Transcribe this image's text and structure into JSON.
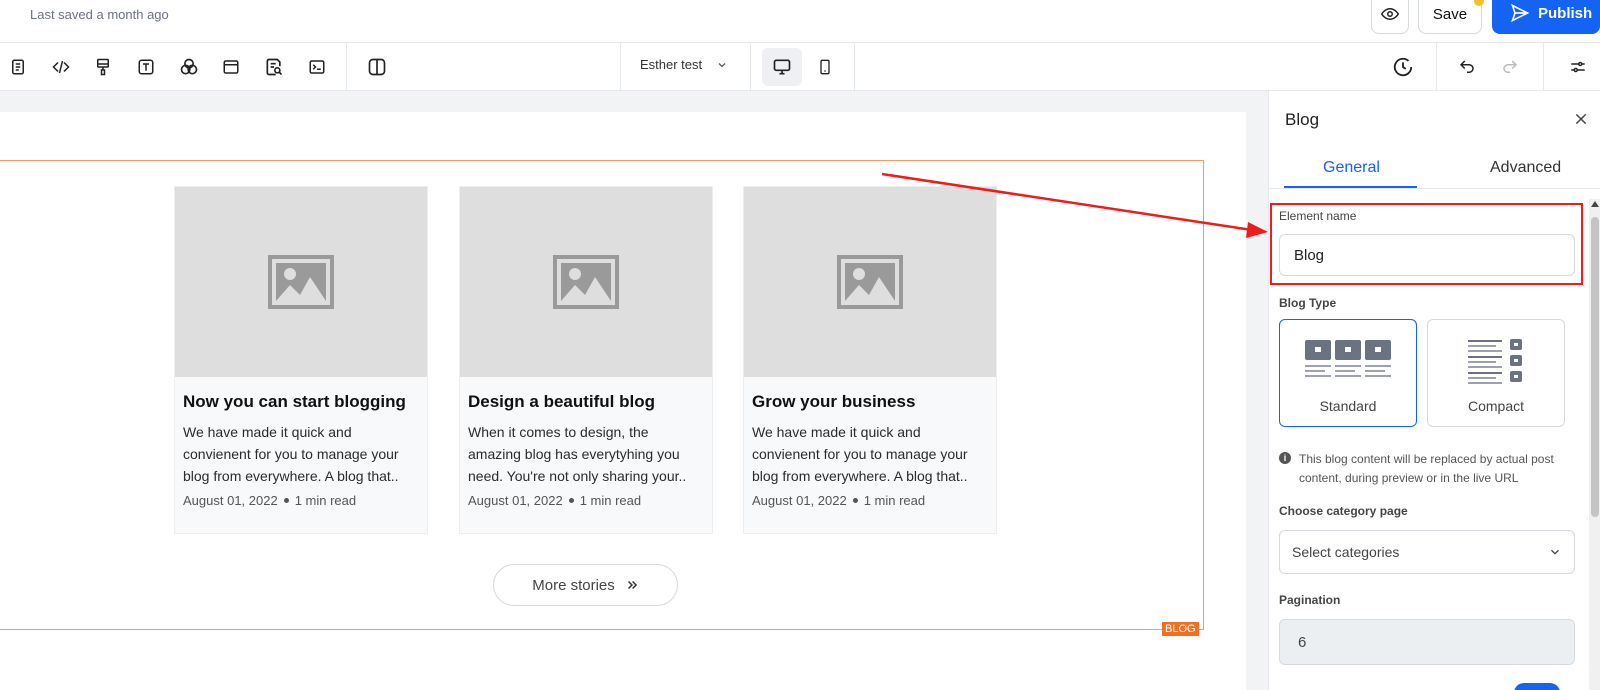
{
  "topbar": {
    "saved_text": "Last saved a month ago",
    "save_label": "Save",
    "publish_label": "Publish"
  },
  "toolbar": {
    "tools": [
      "page-icon",
      "code-icon",
      "paint-brush-icon",
      "text-icon",
      "shapes-icon",
      "layout-icon",
      "seo-search-icon",
      "terminal-icon",
      "columns-icon"
    ],
    "site_name": "Esther test",
    "devices": [
      "desktop",
      "mobile"
    ]
  },
  "canvas": {
    "section_tag": "BLOG",
    "posts": [
      {
        "title": "Now you can start blogging",
        "excerpt": "We have made it quick and convienent for you to manage your blog from everywhere. A blog that..",
        "date": "August 01, 2022",
        "read_time": "1 min read"
      },
      {
        "title": "Design a beautiful blog",
        "excerpt": "When it comes to design, the amazing blog has everytyhing you need. You're not only sharing your..",
        "date": "August 01, 2022",
        "read_time": "1 min read"
      },
      {
        "title": "Grow your business",
        "excerpt": "We have made it quick and convienent for you to manage your blog from everywhere. A blog that..",
        "date": "August 01, 2022",
        "read_time": "1 min read"
      }
    ],
    "more_label": "More stories"
  },
  "panel": {
    "title": "Blog",
    "tabs": [
      "General",
      "Advanced"
    ],
    "element_name_label": "Element name",
    "element_name_value": "Blog",
    "blog_type_label": "Blog Type",
    "blog_types": [
      "Standard",
      "Compact"
    ],
    "selected_type": "Standard",
    "info_text": "This blog content will be replaced by actual post content, during preview or in the live URL",
    "category_label": "Choose category page",
    "category_placeholder": "Select categories",
    "pagination_label": "Pagination",
    "pagination_value": "6"
  },
  "colors": {
    "accent": "#1463f3",
    "frame": "#f29a66",
    "tag": "#f26f21",
    "annotation": "#ef1c1c"
  }
}
